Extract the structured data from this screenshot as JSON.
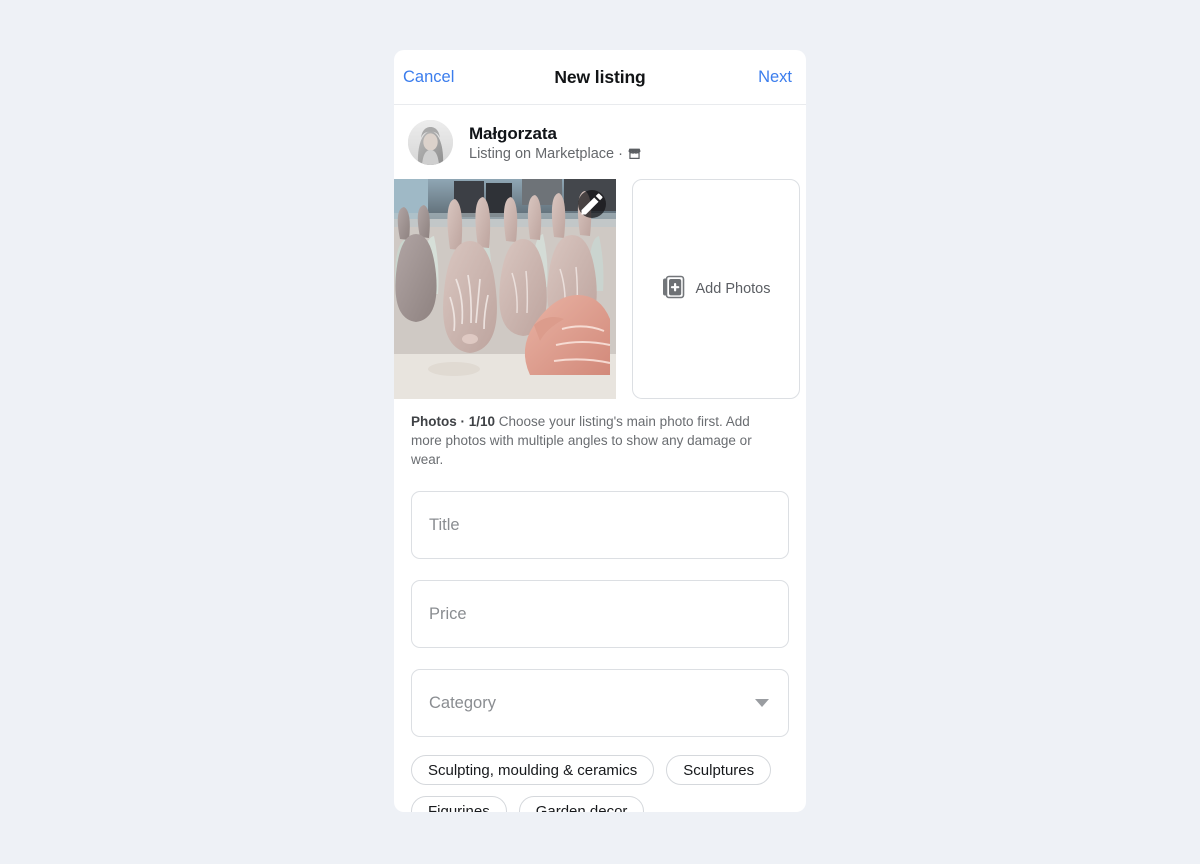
{
  "theme": {
    "page_background": "#eef1f6",
    "card_background": "#ffffff",
    "link_blue": "#3b7ded",
    "text_primary": "#121416",
    "text_secondary": "#65686c",
    "border": "#dcdfe3"
  },
  "header": {
    "cancel_label": "Cancel",
    "title": "New listing",
    "next_label": "Next"
  },
  "profile": {
    "name": "Małgorzata",
    "subtitle": "Listing on Marketplace ·",
    "avatar_icon": "user-avatar-photo",
    "marketplace_icon": "storefront-icon"
  },
  "photos": {
    "thumbnail_alt": "ceramic bunny figurines",
    "edit_icon": "pencil-icon",
    "add_photos_label": "Add Photos",
    "add_photos_icon": "add-photos-icon",
    "caption_label": "Photos · 1/10",
    "caption_text": " Choose your listing's main photo first. Add more photos with multiple angles to show any damage or wear.",
    "count": "1/10"
  },
  "form": {
    "title_placeholder": "Title",
    "price_placeholder": "Price",
    "category_placeholder": "Category",
    "category_value": "",
    "caret_icon": "chevron-down-icon"
  },
  "suggestions": [
    {
      "label": "Sculpting, moulding & ceramics"
    },
    {
      "label": "Sculptures"
    },
    {
      "label": "Figurines"
    },
    {
      "label": "Garden decor"
    }
  ]
}
